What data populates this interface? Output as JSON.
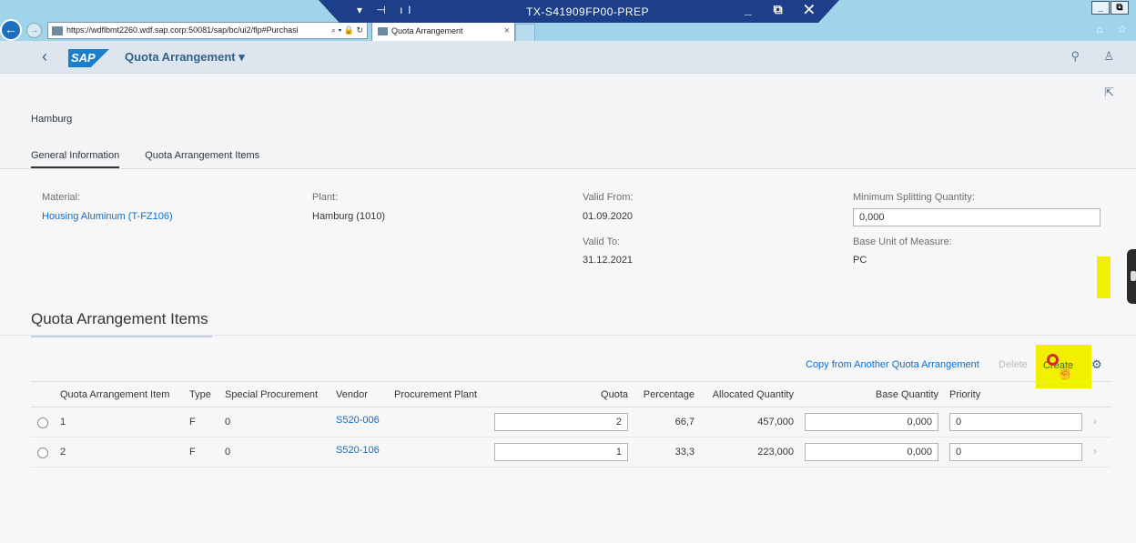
{
  "browser": {
    "url": "https://wdflbmt2260.wdf.sap.corp:50081/sap/bc/ui2/flp#Purchasi",
    "url_controls": "⌕ ▾ 🔒 ↻",
    "tab_title": "Quota Arrangement",
    "tab_close": "×",
    "remote_title": "TX-S41909FP00-PREP",
    "remote_icons": "▾ ⊣ ıl",
    "remote_controls": "_ ⧉ ✕",
    "window_controls": [
      "_",
      "⧉"
    ],
    "right_icons": "⌂ ☆"
  },
  "shell": {
    "back": "‹",
    "logo": "SAP",
    "title": "Quota Arrangement ▾",
    "search_icon": "⚲",
    "user_icon": "♙"
  },
  "header": {
    "share_icon": "⇱",
    "object_title": "Hamburg",
    "anchors": [
      "General Information",
      "Quota Arrangement Items"
    ]
  },
  "general": {
    "material_label": "Material:",
    "material_value": "Housing Aluminum (T-FZ106)",
    "plant_label": "Plant:",
    "plant_value": "Hamburg (1010)",
    "valid_from_label": "Valid From:",
    "valid_from_value": "01.09.2020",
    "valid_to_label": "Valid To:",
    "valid_to_value": "31.12.2021",
    "min_split_label": "Minimum Splitting Quantity:",
    "min_split_value": "0,000",
    "uom_label": "Base Unit of Measure:",
    "uom_value": "PC"
  },
  "items_section": {
    "title": "Quota Arrangement Items",
    "toolbar": {
      "copy": "Copy from Another Quota Arrangement",
      "delete": "Delete",
      "create": "Create",
      "settings_icon": "⚙"
    },
    "columns": [
      "Quota Arrangement Item",
      "Type",
      "Special Procurement",
      "Vendor",
      "Procurement Plant",
      "Quota",
      "Percentage",
      "Allocated Quantity",
      "Base Quantity",
      "Priority"
    ],
    "rows": [
      {
        "item": "1",
        "type": "F",
        "special": "0",
        "vendor": "S520-006",
        "plant": "",
        "quota": "2",
        "percentage": "66,7",
        "allocated": "457,000",
        "base_qty": "0,000",
        "priority": "0"
      },
      {
        "item": "2",
        "type": "F",
        "special": "0",
        "vendor": "S520-106",
        "plant": "",
        "quota": "1",
        "percentage": "33,3",
        "allocated": "223,000",
        "base_qty": "0,000",
        "priority": "0"
      }
    ],
    "row_chevron": "›"
  },
  "colors": {
    "link": "#0a6ed1",
    "highlight": "#f3ef00",
    "shell_bg": "#dde6ef",
    "sap_blue": "#1c7ecb"
  }
}
